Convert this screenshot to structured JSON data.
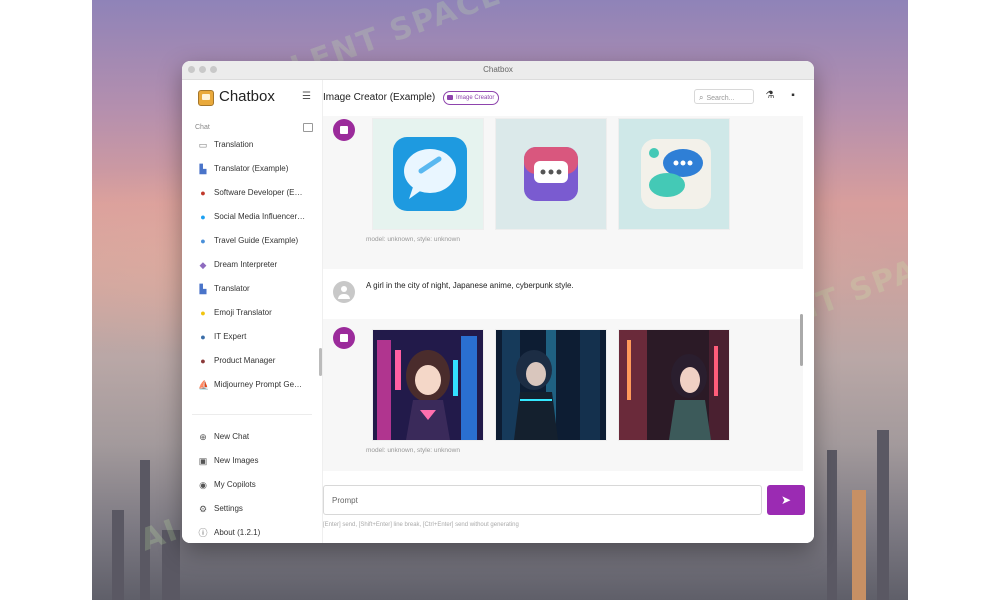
{
  "window": {
    "title": "Chatbox"
  },
  "sidebar": {
    "brand": "Chatbox",
    "section_label": "Chat",
    "items": [
      {
        "label": "Translation",
        "icon": "message-icon"
      },
      {
        "label": "Translator (Example)",
        "icon": "translator-avatar-icon"
      },
      {
        "label": "Software Developer (E…",
        "icon": "developer-avatar-icon"
      },
      {
        "label": "Social Media Influencer…",
        "icon": "twitter-bird-icon"
      },
      {
        "label": "Travel Guide (Example)",
        "icon": "globe-icon"
      },
      {
        "label": "Dream Interpreter",
        "icon": "dream-avatar-icon"
      },
      {
        "label": "Translator",
        "icon": "translator-avatar-icon"
      },
      {
        "label": "Emoji Translator",
        "icon": "sunglasses-emoji-icon"
      },
      {
        "label": "IT Expert",
        "icon": "it-avatar-icon"
      },
      {
        "label": "Product Manager",
        "icon": "manager-avatar-icon"
      },
      {
        "label": "Midjourney Prompt Ge…",
        "icon": "midjourney-sail-icon"
      }
    ],
    "nav": [
      {
        "label": "New Chat",
        "icon": "plus-circle-icon"
      },
      {
        "label": "New Images",
        "icon": "image-icon"
      },
      {
        "label": "My Copilots",
        "icon": "copilot-icon"
      },
      {
        "label": "Settings",
        "icon": "gear-icon"
      },
      {
        "label": "About (1.2.1)",
        "icon": "info-icon"
      }
    ]
  },
  "header": {
    "title": "Image Creator (Example)",
    "badge": "Image Creator",
    "search_placeholder": "Search..."
  },
  "messages": [
    {
      "role": "assistant",
      "meta": "model: unknown, style: unknown",
      "images": [
        "chat-bubble-icon-blue",
        "chat-bubble-icon-gradient",
        "chat-bubble-icon-3d"
      ]
    },
    {
      "role": "user",
      "text": "A girl in the city of night, Japanese anime, cyberpunk style."
    },
    {
      "role": "assistant",
      "meta": "model: unknown, style: unknown",
      "images": [
        "anime-girl-neon-city-1",
        "anime-girl-neon-city-2",
        "anime-girl-neon-city-3"
      ]
    }
  ],
  "composer": {
    "placeholder": "Prompt",
    "hint": "[Enter] send, [Shift+Enter] line break, [Ctrl+Enter] send without generating"
  },
  "watermark": "AI TALENT SPACE",
  "colors": {
    "accent": "#9b2bb3",
    "avatar": "#9b2b9b"
  }
}
